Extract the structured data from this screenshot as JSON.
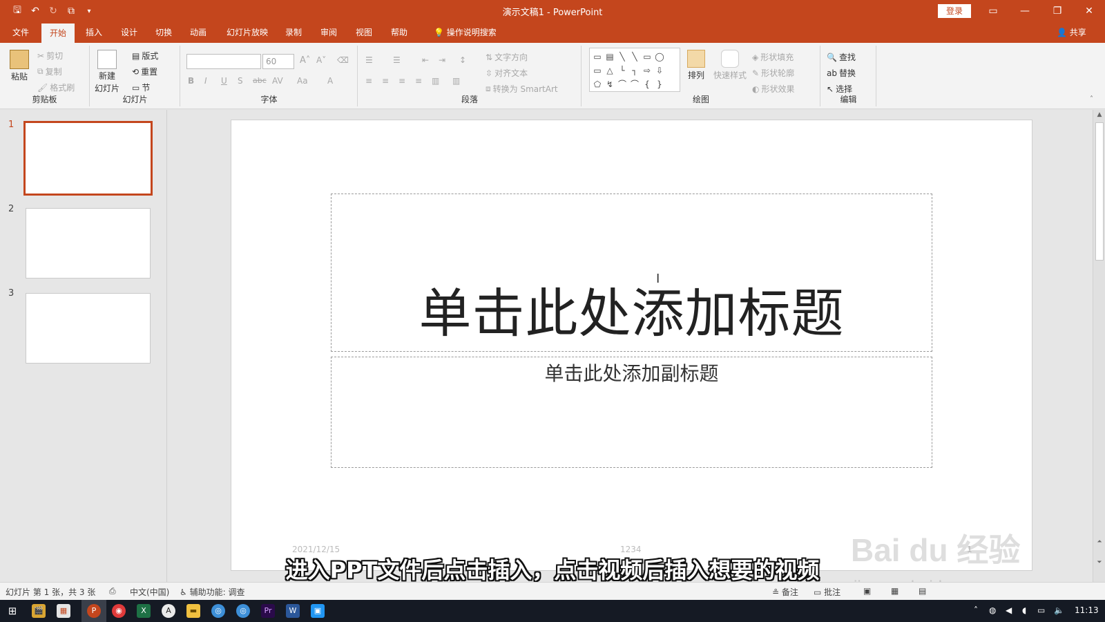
{
  "window": {
    "title": "演示文稿1 - PowerPoint",
    "login_label": "登录",
    "share_label": "共享"
  },
  "tabs": [
    {
      "label": "文件"
    },
    {
      "label": "开始"
    },
    {
      "label": "插入"
    },
    {
      "label": "设计"
    },
    {
      "label": "切换"
    },
    {
      "label": "动画"
    },
    {
      "label": "幻灯片放映"
    },
    {
      "label": "录制"
    },
    {
      "label": "审阅"
    },
    {
      "label": "视图"
    },
    {
      "label": "帮助"
    },
    {
      "label": "操作说明搜索"
    }
  ],
  "ribbon": {
    "clipboard": {
      "label": "剪贴板",
      "paste": "粘贴",
      "cut": "剪切",
      "copy": "复制",
      "format_painter": "格式刷"
    },
    "slides": {
      "label": "幻灯片",
      "new_slide_1": "新建",
      "new_slide_2": "幻灯片",
      "layout": "版式",
      "reset": "重置",
      "section": "节"
    },
    "font": {
      "label": "字体",
      "font_size_value": "60",
      "bold": "B",
      "italic": "I",
      "underline": "U",
      "shadow": "S",
      "strike": "abc",
      "spacing": "AV",
      "case": "Aa",
      "font_color": "A"
    },
    "paragraph": {
      "label": "段落",
      "text_direction": "文字方向",
      "align_text": "对齐文本",
      "smartart": "转换为 SmartArt"
    },
    "drawing": {
      "label": "绘图",
      "arrange": "排列",
      "quick_styles": "快速样式",
      "shape_fill": "形状填充",
      "shape_outline": "形状轮廓",
      "shape_effects": "形状效果",
      "shapes": [
        "▭",
        "▤",
        "╲",
        "╲",
        "▭",
        "◯",
        "",
        "▭",
        "△",
        "└",
        "┐",
        "⇨",
        "⇩",
        "",
        "⬠",
        "↯",
        "⌒",
        "⌒",
        "{",
        "}",
        ""
      ]
    },
    "editing": {
      "label": "编辑",
      "find": "查找",
      "replace": "替换",
      "select": "选择"
    }
  },
  "thumbnails": [
    {
      "number": "1"
    },
    {
      "number": "2"
    },
    {
      "number": "3"
    }
  ],
  "slide": {
    "title_placeholder": "单击此处添加标题",
    "subtitle_placeholder": "单击此处添加副标题",
    "footer_date": "2021/12/15",
    "footer_text": "1234",
    "slide_number": "1"
  },
  "statusbar": {
    "slide_info": "幻灯片 第 1 张，共 3 张",
    "language": "中文(中国)",
    "accessibility": "辅助功能: 调查",
    "notes": "备注",
    "comments": "批注"
  },
  "overlay": {
    "caption": "进入PPT文件后点击插入，点击视频后插入想要的视频",
    "watermark_1": "Bai du 经验",
    "watermark_2": "jingyan.baidu.com"
  },
  "taskbar": {
    "clock": "11:13",
    "apps": [
      {
        "icon": "⊞"
      },
      {
        "icon": "🎬"
      },
      {
        "icon": "▦"
      },
      {
        "icon": "P"
      },
      {
        "icon": "◉"
      },
      {
        "icon": "X"
      },
      {
        "icon": "A"
      },
      {
        "icon": "▬"
      },
      {
        "icon": "◎"
      },
      {
        "icon": "◎"
      },
      {
        "icon": "Pr"
      },
      {
        "icon": "W"
      },
      {
        "icon": "▣"
      }
    ]
  },
  "colors": {
    "accent": "#c4461d",
    "ribbon_bg": "#f3f3f3",
    "taskbar_bg": "#151a24"
  }
}
